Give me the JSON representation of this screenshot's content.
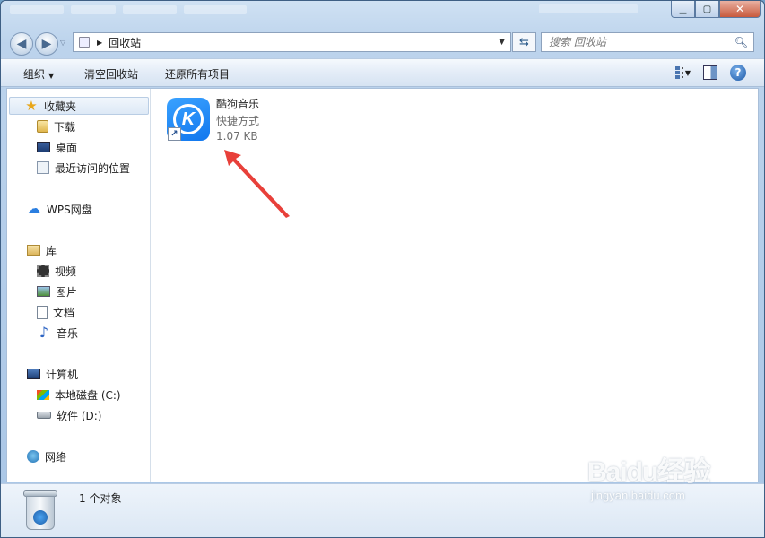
{
  "address": {
    "path": "回收站"
  },
  "search": {
    "placeholder": "搜索 回收站"
  },
  "toolbar": {
    "organize_label": "组织",
    "empty_label": "清空回收站",
    "restore_all_label": "还原所有项目"
  },
  "sidebar": {
    "favorites": {
      "label": "收藏夹",
      "items": [
        {
          "label": "下载"
        },
        {
          "label": "桌面"
        },
        {
          "label": "最近访问的位置"
        }
      ]
    },
    "wps": {
      "label": "WPS网盘"
    },
    "libraries": {
      "label": "库",
      "items": [
        {
          "label": "视频"
        },
        {
          "label": "图片"
        },
        {
          "label": "文档"
        },
        {
          "label": "音乐"
        }
      ]
    },
    "computer": {
      "label": "计算机",
      "items": [
        {
          "label": "本地磁盘 (C:)"
        },
        {
          "label": "软件 (D:)"
        }
      ]
    },
    "network": {
      "label": "网络"
    }
  },
  "files": [
    {
      "name": "酷狗音乐",
      "type": "快捷方式",
      "size": "1.07 KB",
      "icon": "kugou-k-icon",
      "icon_color": "#1a8cff"
    }
  ],
  "status": {
    "count_text": "1 个对象"
  },
  "watermark": {
    "logo": "Baidu经验",
    "url": "jingyan.baidu.com"
  },
  "colors": {
    "accent": "#1a8cff",
    "arrow": "#e8403a"
  }
}
